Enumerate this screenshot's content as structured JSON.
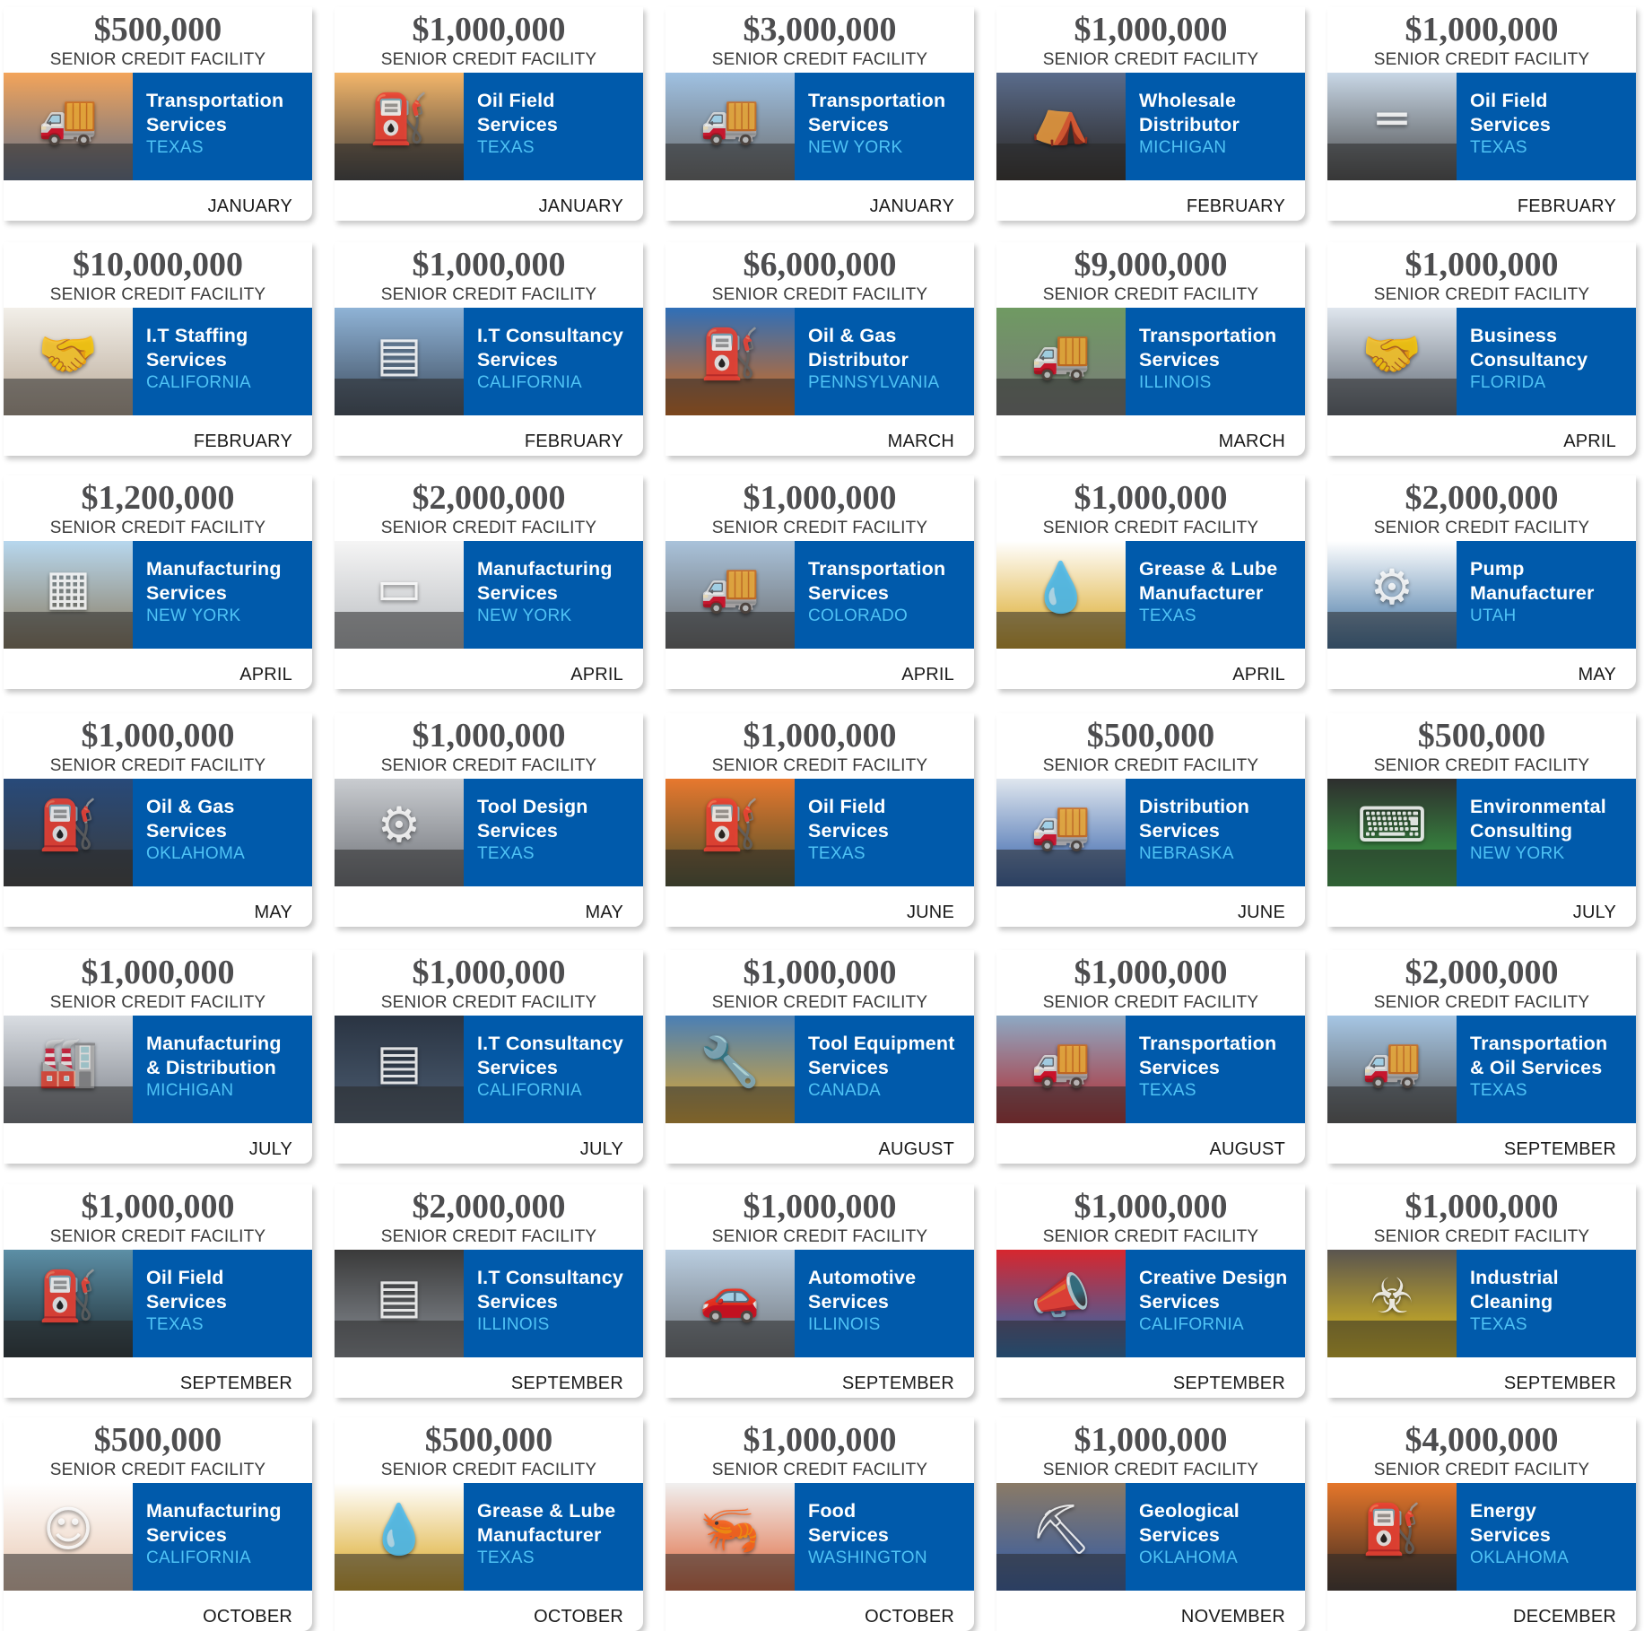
{
  "label_facility": "SENIOR CREDIT FACILITY",
  "colors": {
    "band": "#005aab",
    "state": "#4fc3f5",
    "amount": "#4d4d4f"
  },
  "cards": [
    {
      "amount": "$500,000",
      "industry": "Transportation\nServices",
      "state": "TEXAS",
      "month": "JANUARY",
      "icon": "truck-icon",
      "tint": [
        "#f3a45a",
        "#5f6f8a"
      ]
    },
    {
      "amount": "$1,000,000",
      "industry": "Oil Field\nServices",
      "state": "TEXAS",
      "month": "JANUARY",
      "icon": "oil-pump-icon",
      "tint": [
        "#f4b66a",
        "#3b3a3a"
      ]
    },
    {
      "amount": "$3,000,000",
      "industry": "Transportation\nServices",
      "state": "NEW YORK",
      "month": "JANUARY",
      "icon": "truck-icon",
      "tint": [
        "#9fc1e2",
        "#6b6b6b"
      ]
    },
    {
      "amount": "$1,000,000",
      "industry": "Wholesale\nDistributor",
      "state": "MICHIGAN",
      "month": "FEBRUARY",
      "icon": "tent-icon",
      "tint": [
        "#5a6c8c",
        "#2a2520"
      ]
    },
    {
      "amount": "$1,000,000",
      "industry": "Oil Field\nServices",
      "state": "TEXAS",
      "month": "FEBRUARY",
      "icon": "pipeline-icon",
      "tint": [
        "#c8d7e6",
        "#4a4a4a"
      ]
    },
    {
      "amount": "$10,000,000",
      "industry": "I.T Staffing\nServices",
      "state": "CALIFORNIA",
      "month": "FEBRUARY",
      "icon": "handshake-icon",
      "tint": [
        "#f2efe9",
        "#b8a896"
      ]
    },
    {
      "amount": "$1,000,000",
      "industry": "I.T Consultancy\nServices",
      "state": "CALIFORNIA",
      "month": "FEBRUARY",
      "icon": "server-icon",
      "tint": [
        "#8fb3d6",
        "#3c4a5c"
      ]
    },
    {
      "amount": "$6,000,000",
      "industry": "Oil & Gas\nDistributor",
      "state": "PENNSYLVANIA",
      "month": "MARCH",
      "icon": "fuel-pump-icon",
      "tint": [
        "#2f6fb8",
        "#e06a10"
      ]
    },
    {
      "amount": "$9,000,000",
      "industry": "Transportation\nServices",
      "state": "ILLINOIS",
      "month": "MARCH",
      "icon": "truck-icon",
      "tint": [
        "#6f9a62",
        "#7a7a7a"
      ]
    },
    {
      "amount": "$1,000,000",
      "industry": "Business\nConsultancy",
      "state": "FLORIDA",
      "month": "APRIL",
      "icon": "handshake-icon",
      "tint": [
        "#dfe6ee",
        "#5d6570"
      ]
    },
    {
      "amount": "$1,200,000",
      "industry": "Manufacturing\nServices",
      "state": "NEW YORK",
      "month": "APRIL",
      "icon": "building-icon",
      "tint": [
        "#b7d7ee",
        "#8a7a5e"
      ]
    },
    {
      "amount": "$2,000,000",
      "industry": "Manufacturing\nServices",
      "state": "NEW YORK",
      "month": "APRIL",
      "icon": "paper-icon",
      "tint": [
        "#f5f5f5",
        "#b9bcc0"
      ]
    },
    {
      "amount": "$1,000,000",
      "industry": "Transportation\nServices",
      "state": "COLORADO",
      "month": "APRIL",
      "icon": "truck-icon",
      "tint": [
        "#a9c2da",
        "#6a6a6a"
      ]
    },
    {
      "amount": "$1,000,000",
      "industry": "Grease & Lube\nManufacturer",
      "state": "TEXAS",
      "month": "APRIL",
      "icon": "oil-drop-icon",
      "tint": [
        "#ffffff",
        "#d9a41a"
      ]
    },
    {
      "amount": "$2,000,000",
      "industry": "Pump\nManufacturer",
      "state": "UTAH",
      "month": "MAY",
      "icon": "pump-icon",
      "tint": [
        "#ffffff",
        "#3b6fa0"
      ]
    },
    {
      "amount": "$1,000,000",
      "industry": "Oil & Gas\nServices",
      "state": "OKLAHOMA",
      "month": "MAY",
      "icon": "oil-pump-icon",
      "tint": [
        "#284a7a",
        "#3b3b3b"
      ]
    },
    {
      "amount": "$1,000,000",
      "industry": "Tool Design\nServices",
      "state": "TEXAS",
      "month": "MAY",
      "icon": "gear-icon",
      "tint": [
        "#c9ccd0",
        "#6d7076"
      ]
    },
    {
      "amount": "$1,000,000",
      "industry": "Oil Field\nServices",
      "state": "TEXAS",
      "month": "JUNE",
      "icon": "oil-pump-icon",
      "tint": [
        "#e7782e",
        "#4a4f2a"
      ]
    },
    {
      "amount": "$500,000",
      "industry": "Distribution\nServices",
      "state": "NEBRASKA",
      "month": "JUNE",
      "icon": "truck-icon",
      "tint": [
        "#dfe6ee",
        "#2f5da8"
      ]
    },
    {
      "amount": "$500,000",
      "industry": "Environmental\nConsulting",
      "state": "NEW YORK",
      "month": "JULY",
      "icon": "keyboard-icon",
      "tint": [
        "#2e2e2e",
        "#3aa845"
      ]
    },
    {
      "amount": "$1,000,000",
      "industry": "Manufacturing\n& Distribution",
      "state": "MICHIGAN",
      "month": "JULY",
      "icon": "factory-icon",
      "tint": [
        "#d9dde2",
        "#7c8088"
      ]
    },
    {
      "amount": "$1,000,000",
      "industry": "I.T Consultancy\nServices",
      "state": "CALIFORNIA",
      "month": "JULY",
      "icon": "server-icon",
      "tint": [
        "#2a3442",
        "#4c5d72"
      ]
    },
    {
      "amount": "$1,000,000",
      "industry": "Tool Equipment\nServices",
      "state": "CANADA",
      "month": "AUGUST",
      "icon": "wrench-icon",
      "tint": [
        "#4a7fb5",
        "#e6a92a"
      ]
    },
    {
      "amount": "$1,000,000",
      "industry": "Transportation\nServices",
      "state": "TEXAS",
      "month": "AUGUST",
      "icon": "truck-icon",
      "tint": [
        "#8da9c4",
        "#b3262a"
      ]
    },
    {
      "amount": "$2,000,000",
      "industry": "Transportation\n& Oil Services",
      "state": "TEXAS",
      "month": "SEPTEMBER",
      "icon": "truck-icon",
      "tint": [
        "#a6c6e4",
        "#5a5a5a"
      ]
    },
    {
      "amount": "$1,000,000",
      "industry": "Oil Field\nServices",
      "state": "TEXAS",
      "month": "SEPTEMBER",
      "icon": "oil-pump-icon",
      "tint": [
        "#5c8fa6",
        "#1d2a30"
      ]
    },
    {
      "amount": "$2,000,000",
      "industry": "I.T Consultancy\nServices",
      "state": "ILLINOIS",
      "month": "SEPTEMBER",
      "icon": "server-icon",
      "tint": [
        "#3a3a3a",
        "#8a8f96"
      ]
    },
    {
      "amount": "$1,000,000",
      "industry": "Automotive\nServices",
      "state": "ILLINOIS",
      "month": "SEPTEMBER",
      "icon": "car-icon",
      "tint": [
        "#b9cde0",
        "#6f7378"
      ]
    },
    {
      "amount": "$1,000,000",
      "industry": "Creative Design\nServices",
      "state": "CALIFORNIA",
      "month": "SEPTEMBER",
      "icon": "megaphone-icon",
      "tint": [
        "#d7262e",
        "#1d6fb8"
      ]
    },
    {
      "amount": "$1,000,000",
      "industry": "Industrial\nCleaning",
      "state": "TEXAS",
      "month": "SEPTEMBER",
      "icon": "hazmat-icon",
      "tint": [
        "#5a5550",
        "#e5c21a"
      ]
    },
    {
      "amount": "$500,000",
      "industry": "Manufacturing\nServices",
      "state": "CALIFORNIA",
      "month": "OCTOBER",
      "icon": "face-icon",
      "tint": [
        "#ffffff",
        "#e8c7b0"
      ]
    },
    {
      "amount": "$500,000",
      "industry": "Grease & Lube\nManufacturer",
      "state": "TEXAS",
      "month": "OCTOBER",
      "icon": "oil-drop-icon",
      "tint": [
        "#ffffff",
        "#d9a41a"
      ]
    },
    {
      "amount": "$1,000,000",
      "industry": "Food\nServices",
      "state": "WASHINGTON",
      "month": "OCTOBER",
      "icon": "shrimp-icon",
      "tint": [
        "#f0f0f0",
        "#e0663a"
      ]
    },
    {
      "amount": "$1,000,000",
      "industry": "Geological\nServices",
      "state": "OKLAHOMA",
      "month": "NOVEMBER",
      "icon": "drill-icon",
      "tint": [
        "#8a7a66",
        "#2f5aa8"
      ]
    },
    {
      "amount": "$4,000,000",
      "industry": "Energy\nServices",
      "state": "OKLAHOMA",
      "month": "DECEMBER",
      "icon": "oil-pump-icon",
      "tint": [
        "#e5762a",
        "#3a2a22"
      ]
    }
  ]
}
